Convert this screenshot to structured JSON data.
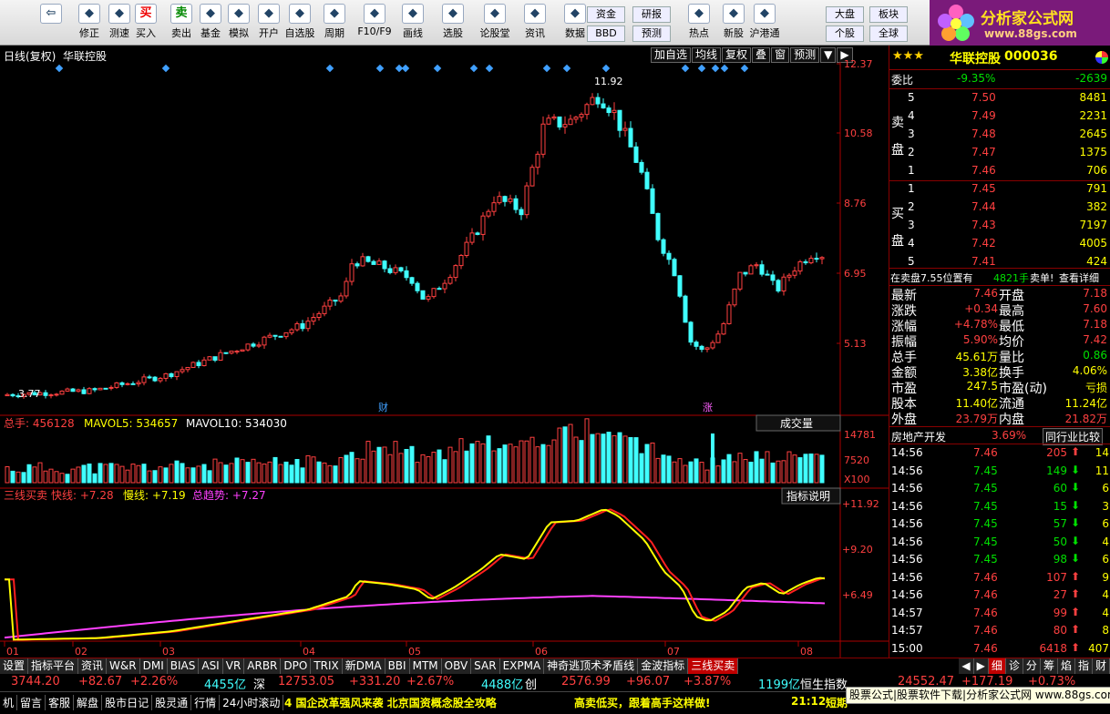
{
  "toolbar": {
    "buttons": [
      {
        "label": "",
        "icon": "back-arrow-icon"
      },
      {
        "label": "修正",
        "icon": "correct-icon"
      },
      {
        "label": "测速",
        "icon": "speed-test-icon"
      },
      {
        "label": "买入",
        "icon": "buy-icon",
        "glyph": "买"
      },
      {
        "label": "卖出",
        "icon": "sell-icon",
        "glyph": "卖"
      },
      {
        "label": "基金",
        "icon": "fund-icon"
      },
      {
        "label": "模拟",
        "icon": "simulate-icon"
      },
      {
        "label": "开户",
        "icon": "open-account-icon"
      },
      {
        "label": "自选股",
        "icon": "watchlist-icon"
      },
      {
        "label": "周期",
        "icon": "period-icon"
      },
      {
        "label": "F10/F9",
        "icon": "f10-icon"
      },
      {
        "label": "画线",
        "icon": "draw-line-icon"
      },
      {
        "label": "选股",
        "icon": "stock-select-icon"
      },
      {
        "label": "论股堂",
        "icon": "forum-icon"
      },
      {
        "label": "资讯",
        "icon": "news-icon"
      },
      {
        "label": "数据",
        "icon": "data-icon"
      },
      {
        "label": "热点",
        "icon": "hot-icon"
      },
      {
        "label": "新股",
        "icon": "new-stock-icon"
      },
      {
        "label": "沪港通",
        "icon": "hk-connect-icon"
      }
    ],
    "small": [
      "资金",
      "BBD",
      "研报",
      "预测",
      "大盘",
      "个股",
      "板块",
      "全球"
    ],
    "logo_title": "分析家公式网",
    "logo_url": "www.88gs.com"
  },
  "chart": {
    "title": "日线(复权)",
    "stock": "华联控股",
    "top_buttons": [
      "加自选",
      "均线",
      "复权",
      "叠",
      "窗",
      "预测",
      "▼",
      "▶"
    ],
    "price_ticks": [
      "12.37",
      "10.58",
      "8.76",
      "6.95",
      "5.13"
    ],
    "high_label": "11.92",
    "low_label": "3.77",
    "marker_cai": "财",
    "marker_zhang": "涨",
    "month_labels": [
      "01",
      "02",
      "03",
      "04",
      "05",
      "06",
      "07",
      "08"
    ],
    "vol_title": "总手: 456128",
    "vol_ma5": "MAVOL5: 534657",
    "vol_ma10": "MAVOL10: 534030",
    "vol_dropdown": "成交量",
    "vol_ticks": [
      "14781",
      "7520",
      "X100"
    ],
    "ind_name": "三线买卖",
    "ind_fast": "快线: +7.28",
    "ind_slow": "慢线: +7.19",
    "ind_trend": "总趋势: +7.27",
    "ind_help": "指标说明",
    "ind_ticks": [
      "+11.92",
      "+9.20",
      "+6.49"
    ]
  },
  "quote": {
    "name": "华联控股",
    "code": "000036",
    "wei_bi_label": "委比",
    "wei_bi": "-9.35%",
    "wei_cha": "-2639",
    "sell_label": "卖盘",
    "buy_label": "买盘",
    "sell": [
      {
        "n": "5",
        "p": "7.50",
        "v": "8481"
      },
      {
        "n": "4",
        "p": "7.49",
        "v": "2231"
      },
      {
        "n": "3",
        "p": "7.48",
        "v": "2645"
      },
      {
        "n": "2",
        "p": "7.47",
        "v": "1375"
      },
      {
        "n": "1",
        "p": "7.46",
        "v": "706"
      }
    ],
    "buy": [
      {
        "n": "1",
        "p": "7.45",
        "v": "791"
      },
      {
        "n": "2",
        "p": "7.44",
        "v": "382"
      },
      {
        "n": "3",
        "p": "7.43",
        "v": "7197"
      },
      {
        "n": "4",
        "p": "7.42",
        "v": "4005"
      },
      {
        "n": "5",
        "p": "7.41",
        "v": "424"
      }
    ],
    "notice": "在卖盘7.55位置有",
    "notice_vol": "4821手",
    "notice_tag": "卖单!",
    "notice_link": "查看详细",
    "stats": [
      {
        "l1": "最新",
        "v1": "7.46",
        "l2": "开盘",
        "v2": "7.18"
      },
      {
        "l1": "涨跌",
        "v1": "+0.34",
        "l2": "最高",
        "v2": "7.60"
      },
      {
        "l1": "涨幅",
        "v1": "+4.78%",
        "l2": "最低",
        "v2": "7.18"
      },
      {
        "l1": "振幅",
        "v1": "5.90%",
        "l2": "均价",
        "v2": "7.42"
      },
      {
        "l1": "总手",
        "v1": "45.61万",
        "l2": "量比",
        "v2": "0.86"
      },
      {
        "l1": "金额",
        "v1": "3.38亿",
        "l2": "换手",
        "v2": "4.06%"
      },
      {
        "l1": "市盈",
        "v1": "247.5",
        "l2": "市盈(动)",
        "v2": "亏损"
      },
      {
        "l1": "股本",
        "v1": "11.40亿",
        "l2": "流通",
        "v2": "11.24亿"
      },
      {
        "l1": "外盘",
        "v1": "23.79万",
        "l2": "内盘",
        "v2": "21.82万"
      }
    ],
    "sector": "房地产开发",
    "sector_chg": "3.69%",
    "sector_cmp": "同行业比较",
    "ticks": [
      {
        "t": "14:56",
        "p": "7.46",
        "v": "205",
        "dir": "up",
        "n": "14"
      },
      {
        "t": "14:56",
        "p": "7.45",
        "v": "149",
        "dir": "down",
        "n": "11"
      },
      {
        "t": "14:56",
        "p": "7.45",
        "v": "60",
        "dir": "down",
        "n": "6"
      },
      {
        "t": "14:56",
        "p": "7.45",
        "v": "15",
        "dir": "down",
        "n": "3"
      },
      {
        "t": "14:56",
        "p": "7.45",
        "v": "57",
        "dir": "down",
        "n": "6"
      },
      {
        "t": "14:56",
        "p": "7.45",
        "v": "50",
        "dir": "down",
        "n": "4"
      },
      {
        "t": "14:56",
        "p": "7.45",
        "v": "98",
        "dir": "down",
        "n": "6"
      },
      {
        "t": "14:56",
        "p": "7.46",
        "v": "107",
        "dir": "up",
        "n": "9"
      },
      {
        "t": "14:56",
        "p": "7.46",
        "v": "27",
        "dir": "up",
        "n": "4"
      },
      {
        "t": "14:57",
        "p": "7.46",
        "v": "99",
        "dir": "up",
        "n": "4"
      },
      {
        "t": "14:57",
        "p": "7.46",
        "v": "80",
        "dir": "up",
        "n": "8"
      },
      {
        "t": "15:00",
        "p": "7.46",
        "v": "6418",
        "dir": "up",
        "n": "407"
      }
    ]
  },
  "tabs": [
    "设置",
    "指标平台",
    "资讯",
    "W&R",
    "DMI",
    "BIAS",
    "ASI",
    "VR",
    "ARBR",
    "DPO",
    "TRIX",
    "新DMA",
    "BBI",
    "MTM",
    "OBV",
    "SAR",
    "EXPMA",
    "神奇逃顶术矛盾线",
    "金波指标",
    "三线买卖"
  ],
  "right_tabs": [
    "◀",
    "▶",
    "细",
    "诊",
    "分",
    "筹",
    "焰",
    "指",
    "财"
  ],
  "status1": {
    "sh": "3744.20",
    "sh_chg": "+82.67",
    "sh_pct": "+2.26%",
    "sh_amt": "4455亿",
    "sz_label": "深",
    "sz": "12753.05",
    "sz_chg": "+331.20",
    "sz_pct": "+2.67%",
    "sz_amt": "4488亿",
    "cy_label": "创",
    "cy": "2576.99",
    "cy_chg": "+96.07",
    "cy_pct": "+3.87%",
    "hs_amt": "1199亿",
    "hs_label": "恒生指数",
    "hs": "24552.47",
    "hs_chg": "+177.19",
    "hs_pct": "+0.73%"
  },
  "status2": {
    "items": [
      "机",
      "留言",
      "客服",
      "解盘",
      "股市日记",
      "股灵通",
      "行情",
      "24小时滚动"
    ],
    "news1": "4 国企改革强风来袭 北京国资概念股全攻略",
    "news2": "高卖低买，跟着高手这样做!",
    "time": "21:12",
    "tail": "短期",
    "ad": "股票公式|股票软件下载|分析家公式网 www.88gs.com"
  }
}
